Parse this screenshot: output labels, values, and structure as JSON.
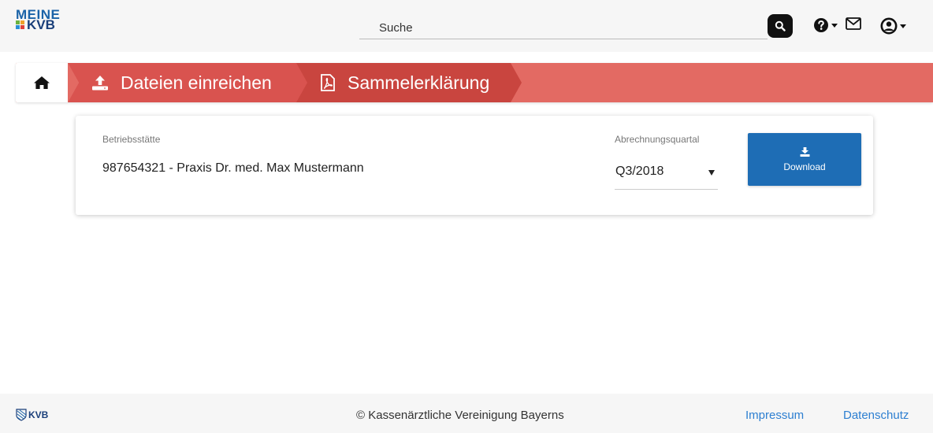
{
  "header": {
    "logo_line1": "MEINE",
    "logo_line2": "KVB",
    "search_placeholder": "Suche",
    "icons": [
      "search-icon",
      "help-icon",
      "mail-icon",
      "user-icon"
    ]
  },
  "breadcrumb": {
    "home_icon": "home-icon",
    "items": [
      {
        "label": "Dateien einreichen",
        "icon": "upload-icon"
      },
      {
        "label": "Sammelerklärung",
        "icon": "pdf-icon"
      }
    ]
  },
  "card": {
    "site_label": "Betriebsstätte",
    "site_value": "987654321 - Praxis Dr. med. Max Mustermann",
    "quarter_label": "Abrechnungsquartal",
    "quarter_value": "Q3/2018",
    "download_label": "Download"
  },
  "footer": {
    "logo_text": "KVB",
    "copyright": "© Kassenärztliche Vereinigung Bayerns",
    "links": [
      "Impressum",
      "Datenschutz"
    ]
  },
  "colors": {
    "breadcrumb_bar": "#e36a63",
    "breadcrumb_item": "#d9534f",
    "breadcrumb_item_active": "#c9453f",
    "download_button": "#1e6db5",
    "link": "#2d7fd1",
    "logo_blue": "#1a63a8"
  }
}
